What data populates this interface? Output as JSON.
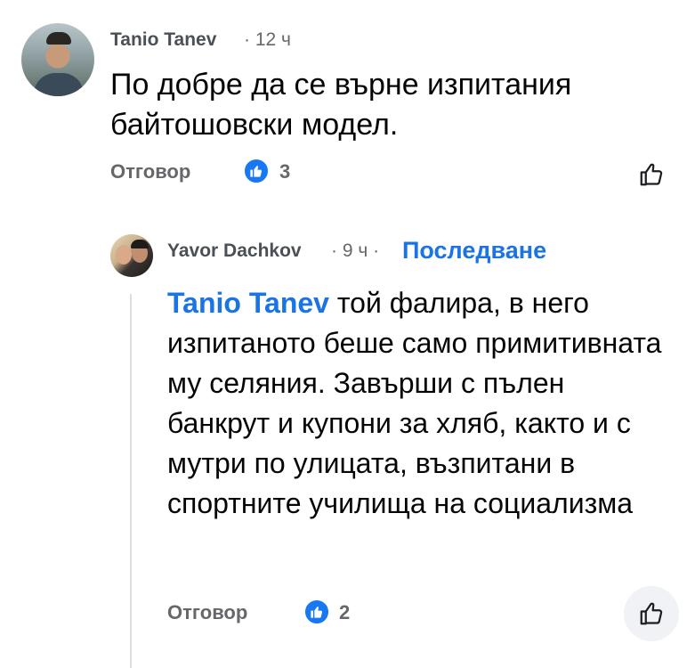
{
  "comment": {
    "author": "Tanio Tanev",
    "meta": "· 12 ч",
    "text": "По добре да се върне изпитания байтошовски модел.",
    "reply_label": "Отговор",
    "like_count": "3"
  },
  "reply": {
    "author": "Yavor Dachkov",
    "meta": "· 9 ч ·",
    "follow_label": "Последване",
    "mention": "Tanio Tanev",
    "text": " той фалира, в него изпитаното беше само примитивната му селяния. Завърши с пълен банкрут и купони за хляб, както и с мутри по улицата, възпитани в спортните училища на социализма",
    "reply_label": "Отговор",
    "like_count": "2"
  },
  "colors": {
    "accent": "#1b74e4",
    "like_badge": "#1877f2",
    "secondary_text": "#65676b",
    "thread_line": "#dadde1"
  },
  "icons": {
    "like_badge": "thumbs-up-icon",
    "like_button": "thumbs-up-outline-icon"
  }
}
